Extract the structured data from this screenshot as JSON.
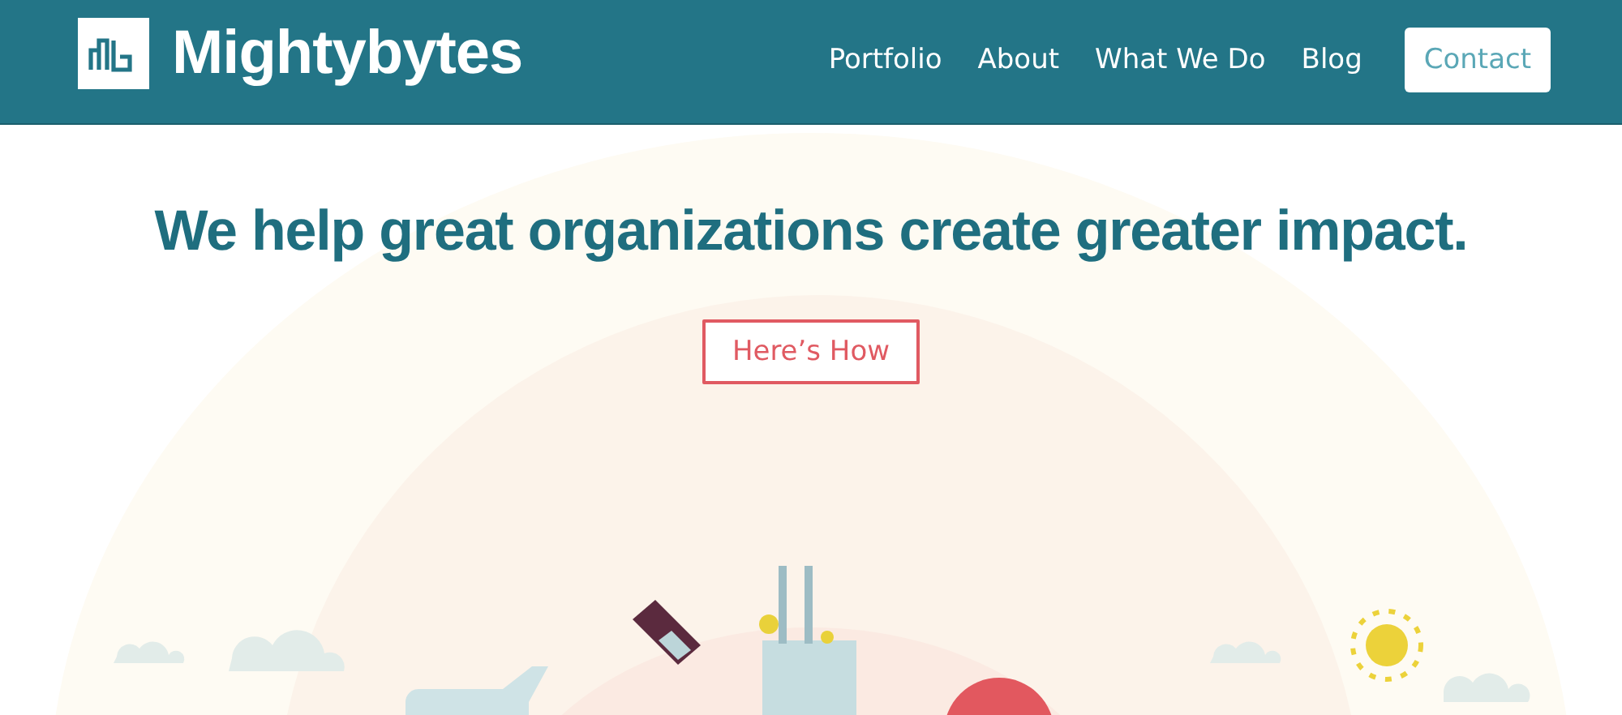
{
  "header": {
    "brand": "Mightybytes",
    "nav": [
      {
        "label": "Portfolio",
        "kind": "link"
      },
      {
        "label": "About",
        "kind": "link"
      },
      {
        "label": "What We Do",
        "kind": "link"
      },
      {
        "label": "Blog",
        "kind": "link"
      },
      {
        "label": "Contact",
        "kind": "button"
      }
    ]
  },
  "hero": {
    "headline": "We help great organizations create greater impact.",
    "cta": "Here’s How"
  }
}
